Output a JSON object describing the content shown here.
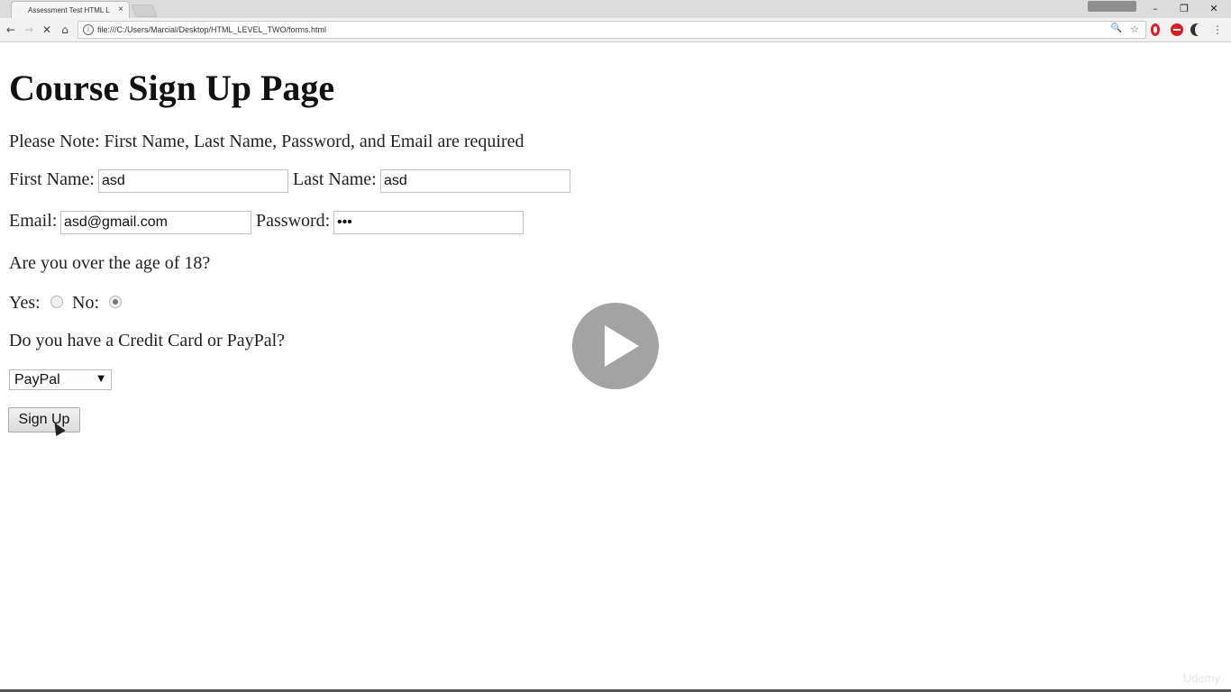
{
  "browser": {
    "tab_title": "Assessment Test HTML L",
    "tab_close": "×",
    "profile_label": "",
    "url": "file:///C:/Users/Marcial/Desktop/HTML_LEVEL_TWO/forms.html",
    "window_minimize": "–",
    "window_restore": "❐",
    "window_close": "✕",
    "back": "←",
    "forward": "→",
    "reload_stop": "✕",
    "home": "⌂",
    "info": "i",
    "zoom": "🔍",
    "star": "☆",
    "menu": "⋮"
  },
  "page": {
    "title": "Course Sign Up Page",
    "note": "Please Note: First Name, Last Name, Password, and Email are required",
    "first_name_label": "First Name:",
    "first_name_value": "asd",
    "last_name_label": "Last Name:",
    "last_name_value": "asd",
    "email_label": "Email:",
    "email_value": "asd@gmail.com",
    "password_label": "Password:",
    "password_value": "•••",
    "age_question": "Are you over the age of 18?",
    "yes_label": "Yes:",
    "no_label": "No:",
    "age_selected": "No",
    "payment_question": "Do you have a Credit Card or PayPal?",
    "payment_selected": "PayPal",
    "payment_arrow": "▼",
    "signup_button": "Sign Up"
  },
  "overlay": {
    "watermark": "Udemy"
  }
}
